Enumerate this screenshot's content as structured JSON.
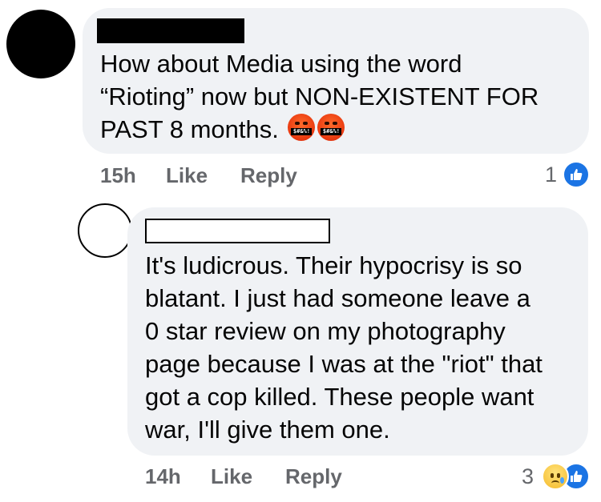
{
  "comments": [
    {
      "lines": [
        "How about Media using the word",
        "“Rioting” now but NON-EXISTENT FOR",
        "PAST 8 months."
      ],
      "emojis": [
        "enraged-face-with-symbols-icon",
        "enraged-face-with-symbols-icon"
      ],
      "emoji_symbols": "$#&%!",
      "time": "15h",
      "like_label": "Like",
      "reply_label": "Reply",
      "reaction_count": "1",
      "reactions": [
        "like"
      ]
    },
    {
      "lines": [
        "It's ludicrous.  Their hypocrisy is so",
        "blatant.  I just had someone leave a",
        "0 star review on my photography",
        "page because I was at the \"riot\" that",
        "got a cop killed. These people want",
        "war, I'll give them one."
      ],
      "time": "14h",
      "like_label": "Like",
      "reply_label": "Reply",
      "reaction_count": "3",
      "reactions": [
        "sad",
        "like"
      ]
    }
  ],
  "colors": {
    "bubble": "#f0f2f5",
    "meta_text": "#65676b",
    "like_blue": "#1b74e4"
  }
}
